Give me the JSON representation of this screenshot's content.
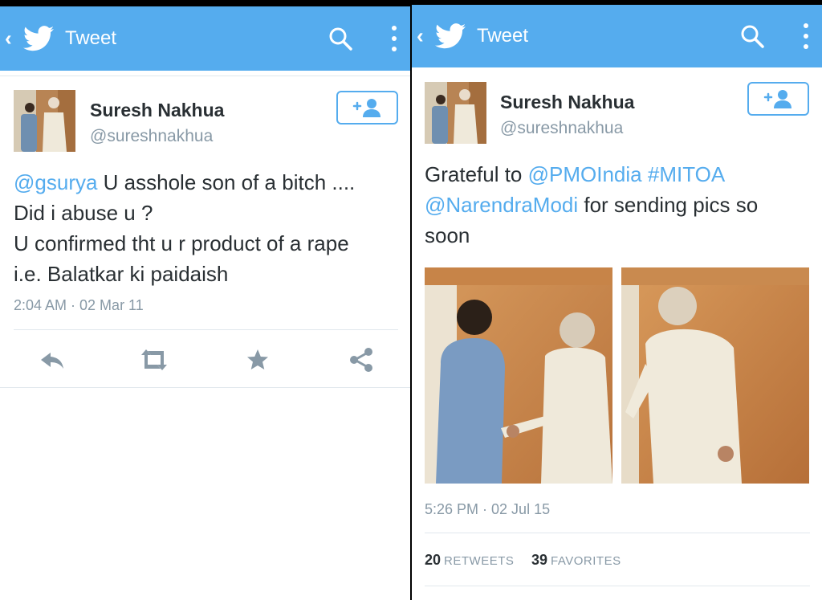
{
  "left_screen": {
    "header": {
      "title": "Tweet",
      "back_icon": "chevron-left-icon",
      "logo_icon": "twitter-bird-icon",
      "search_icon": "search-icon",
      "menu_icon": "overflow-menu-icon"
    },
    "user": {
      "display_name": "Suresh Nakhua",
      "handle": "@sureshnakhua"
    },
    "tweet": {
      "mention": "@gsurya",
      "line1_rest": " U asshole son of a bitch ....",
      "line2": "Did i abuse u ?",
      "line3": "U confirmed tht u r product of a rape",
      "line4": "i.e. Balatkar ki paidaish",
      "timestamp": "2:04 AM · 02 Mar 11"
    },
    "actions": [
      "reply-icon",
      "retweet-icon",
      "favorite-icon",
      "share-icon"
    ]
  },
  "right_screen": {
    "header": {
      "title": "Tweet",
      "back_icon": "chevron-left-icon",
      "logo_icon": "twitter-bird-icon",
      "search_icon": "search-icon",
      "menu_icon": "overflow-menu-icon"
    },
    "user": {
      "display_name": "Suresh Nakhua",
      "handle": "@sureshnakhua"
    },
    "tweet": {
      "line1_plain": "Grateful to ",
      "mention_pmo": "@PMOIndia",
      "hashtag": "#MITOA",
      "mention_modi": "@NarendraModi",
      "line2_rest": " for sending pics so",
      "line3": "soon",
      "timestamp": "5:26 PM · 02 Jul 15"
    },
    "stats": {
      "retweets_count": "20",
      "retweets_label": "RETWEETS",
      "favorites_count": "39",
      "favorites_label": "FAVORITES"
    }
  },
  "colors": {
    "twitter_blue": "#55acee",
    "text": "#292f33",
    "muted": "#8899a6",
    "divider": "#e1e8ed"
  }
}
